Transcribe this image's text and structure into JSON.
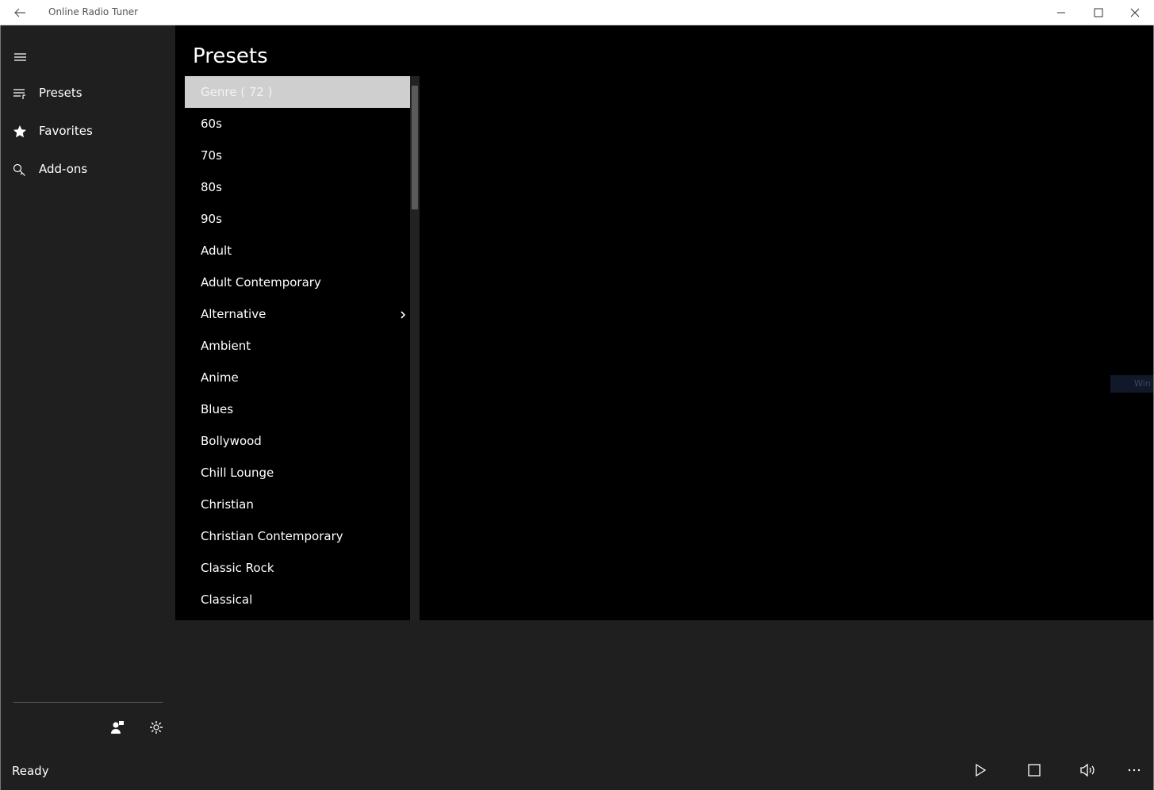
{
  "window": {
    "title": "Online Radio Tuner"
  },
  "nav": {
    "items": [
      {
        "label": "Presets",
        "icon": "presets-list-icon"
      },
      {
        "label": "Favorites",
        "icon": "star-icon"
      },
      {
        "label": "Add-ons",
        "icon": "add-ons-icon"
      }
    ]
  },
  "page": {
    "title": "Presets"
  },
  "list": {
    "items": [
      "Genre ( 72 )",
      "60s",
      "70s",
      "80s",
      "90s",
      "Adult",
      "Adult Contemporary",
      "Alternative",
      "Ambient",
      "Anime",
      "Blues",
      "Bollywood",
      "Chill Lounge",
      "Christian",
      "Christian Contemporary",
      "Classic Rock",
      "Classical"
    ],
    "selected_index": 0,
    "expandable_index": 7
  },
  "watermark": {
    "text": "Win"
  },
  "status": {
    "text": "Ready"
  },
  "colors": {
    "selected_bg": "#cfcfcf",
    "content_bg": "#000000",
    "chrome_bg": "#1f1f1f"
  }
}
